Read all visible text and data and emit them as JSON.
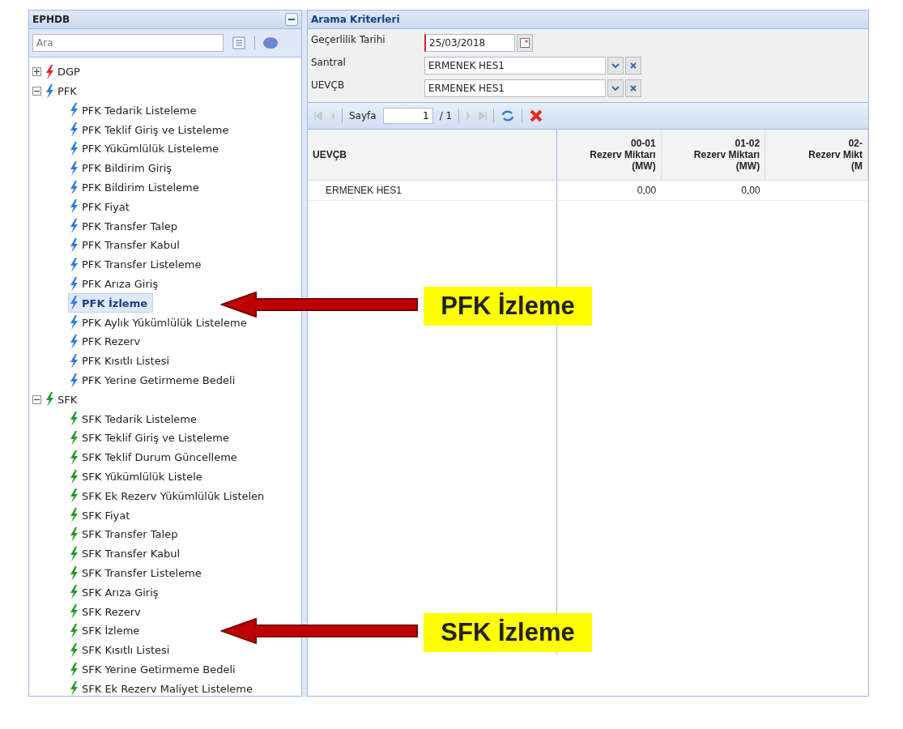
{
  "sidebar": {
    "title": "EPHDB",
    "search": {
      "placeholder": "Ara"
    },
    "tree": [
      {
        "label": "DGP",
        "color": "#e8202a",
        "expanded": false
      },
      {
        "label": "PFK",
        "color": "#2a7de1",
        "expanded": true,
        "children": [
          {
            "label": "PFK Tedarik Listeleme",
            "selected": false
          },
          {
            "label": "PFK Teklif Giriş ve Listeleme",
            "selected": false
          },
          {
            "label": "PFK Yükümlülük Listeleme",
            "selected": false
          },
          {
            "label": "PFK Bildirim Giriş",
            "selected": false
          },
          {
            "label": "PFK Bildirim Listeleme",
            "selected": false
          },
          {
            "label": "PFK Fiyat",
            "selected": false
          },
          {
            "label": "PFK Transfer Talep",
            "selected": false
          },
          {
            "label": "PFK Transfer Kabul",
            "selected": false
          },
          {
            "label": "PFK Transfer Listeleme",
            "selected": false
          },
          {
            "label": "PFK Arıza Giriş",
            "selected": false
          },
          {
            "label": "PFK İzleme",
            "selected": true
          },
          {
            "label": "PFK Aylık Yükümlülük Listeleme",
            "selected": false
          },
          {
            "label": "PFK Rezerv",
            "selected": false
          },
          {
            "label": "PFK Kısıtlı Listesi",
            "selected": false
          },
          {
            "label": "PFK Yerine Getirmeme Bedeli",
            "selected": false
          }
        ]
      },
      {
        "label": "SFK",
        "color": "#1f9a2a",
        "expanded": true,
        "children": [
          {
            "label": "SFK Tedarik Listeleme",
            "selected": false
          },
          {
            "label": "SFK Teklif Giriş ve Listeleme",
            "selected": false
          },
          {
            "label": "SFK Teklif Durum Güncelleme",
            "selected": false
          },
          {
            "label": "SFK Yükümlülük Listele",
            "selected": false
          },
          {
            "label": "SFK Ek Rezerv Yükümlülük Listelen",
            "selected": false
          },
          {
            "label": "SFK Fiyat",
            "selected": false
          },
          {
            "label": "SFK Transfer Talep",
            "selected": false
          },
          {
            "label": "SFK Transfer Kabul",
            "selected": false
          },
          {
            "label": "SFK Transfer Listeleme",
            "selected": false
          },
          {
            "label": "SFK Arıza Giriş",
            "selected": false
          },
          {
            "label": "SFK Rezerv",
            "selected": false
          },
          {
            "label": "SFK İzleme",
            "selected": false
          },
          {
            "label": "SFK Kısıtlı Listesi",
            "selected": false
          },
          {
            "label": "SFK Yerine Getirmeme Bedeli",
            "selected": false
          },
          {
            "label": "SFK Ek Rezerv Maliyet Listeleme",
            "selected": false
          }
        ]
      }
    ]
  },
  "search_panel": {
    "title": "Arama Kriterleri",
    "fields": [
      {
        "kind": "date",
        "label": "Geçerlilik Tarihi",
        "value": "25/03/2018"
      },
      {
        "kind": "combo",
        "label": "Santral",
        "value": "ERMENEK HES1"
      },
      {
        "kind": "combo",
        "label": "UEVÇB",
        "value": "ERMENEK HES1"
      }
    ]
  },
  "pager": {
    "label": "Sayfa",
    "page": "1",
    "total": "/ 1"
  },
  "table": {
    "columns": [
      {
        "lines": [
          "UEVÇB"
        ]
      },
      {
        "lines": [
          "00-01",
          "Rezerv Miktarı",
          "(MW)"
        ]
      },
      {
        "lines": [
          "01-02",
          "Rezerv Miktarı",
          "(MW)"
        ]
      },
      {
        "lines": [
          "02-",
          "Rezerv Mikt",
          "(M"
        ]
      }
    ],
    "rows": [
      [
        "ERMENEK HES1",
        "0,00",
        "0,00",
        ""
      ]
    ]
  },
  "callouts": [
    {
      "label": "PFK İzleme"
    },
    {
      "label": "SFK İzleme"
    }
  ]
}
